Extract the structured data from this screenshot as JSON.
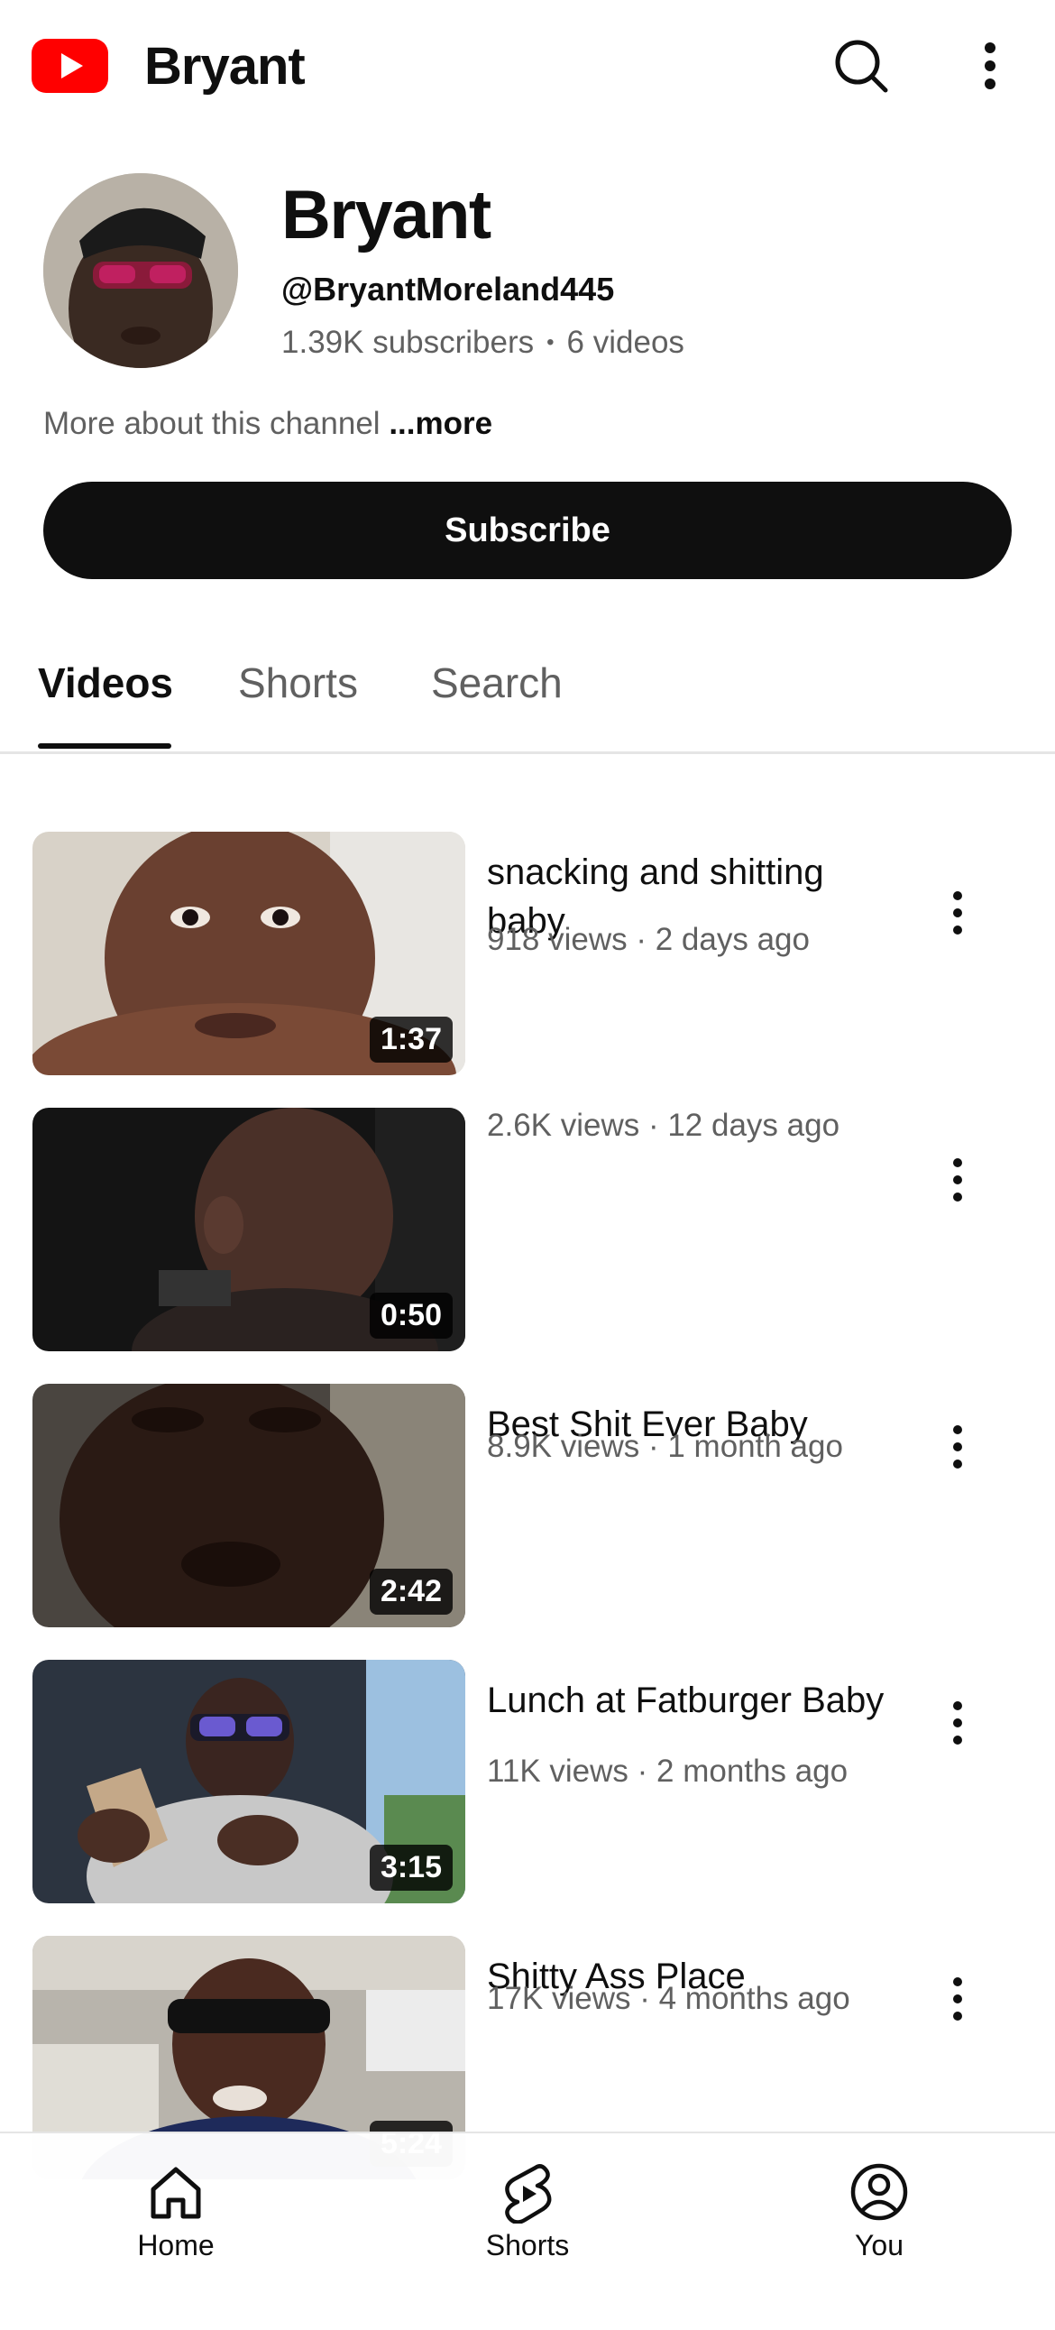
{
  "topbar": {
    "channel_name": "Bryant",
    "brand_color": "#FF0000"
  },
  "channel": {
    "name": "Bryant",
    "handle": "@BryantMoreland445",
    "subscribers": "1.39K subscribers",
    "separator": "•",
    "video_count": "6 videos",
    "about_text": "More about this channel",
    "about_more": "...more",
    "subscribe_label": "Subscribe"
  },
  "tabs": [
    {
      "label": "Videos",
      "active": true
    },
    {
      "label": "Shorts",
      "active": false
    },
    {
      "label": "Search",
      "active": false
    }
  ],
  "videos": [
    {
      "title": "snacking and shitting baby",
      "meta": "918 views · 2 days ago",
      "duration": "1:37"
    },
    {
      "title": "",
      "meta": "2.6K views · 12 days ago",
      "duration": "0:50"
    },
    {
      "title": "Best Shit Ever Baby",
      "meta": "8.9K views · 1 month ago",
      "duration": "2:42"
    },
    {
      "title": "Lunch at Fatburger Baby",
      "meta": "11K views · 2 months ago",
      "duration": "3:15"
    },
    {
      "title": "Shitty Ass Place",
      "meta": "17K views · 4 months ago",
      "duration": "5:24"
    }
  ],
  "bottom_nav": [
    {
      "label": "Home",
      "icon": "home-icon"
    },
    {
      "label": "Shorts",
      "icon": "shorts-icon"
    },
    {
      "label": "You",
      "icon": "account-icon"
    }
  ]
}
